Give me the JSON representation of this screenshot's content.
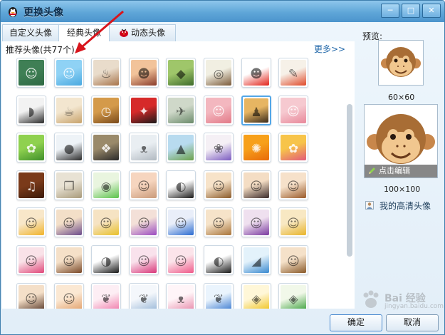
{
  "window": {
    "title": "更换头像",
    "accent_color": "#4b94cc",
    "controls": {
      "minimize_icon": "minimize-icon",
      "maximize_icon": "maximize-icon",
      "close_icon": "close-icon"
    }
  },
  "tabs": [
    {
      "label": "自定义头像",
      "active": false
    },
    {
      "label": "经典头像",
      "active": true
    },
    {
      "label": "动态头像",
      "active": false
    }
  ],
  "recommended": {
    "label": "推荐头像(共77个)",
    "more_link": "更多>>"
  },
  "avatars": [
    [
      "chalkboard-face",
      "sky-smile-face",
      "coffee-art",
      "opera-mask-lady",
      "penguin-photo",
      "latte-cup",
      "red-cartoon-face",
      "colored-pencils"
    ],
    [
      "computer-mouse",
      "tea-set",
      "clock-ornament",
      "opera-mask-red",
      "hummingbird",
      "pink-silhouette",
      "penguin-couple",
      "pink-silhouette-2"
    ],
    [
      "grass",
      "baby-penguin",
      "dog",
      "white-cat",
      "landscape-horse",
      "opera-costume",
      "orange-abstract",
      "pink-flower"
    ],
    [
      "violin",
      "book-glasses",
      "green-ring",
      "baby-face",
      "qq-penguin",
      "anime-boy-brown",
      "anime-boy-dark",
      "anime-girl-brown"
    ],
    [
      "anime-blonde",
      "anime-glasses",
      "anime-blonde-2",
      "anime-purple",
      "anime-blue",
      "anime-brown",
      "anime-purple-2",
      "anime-blonde-3"
    ],
    [
      "anime-pink",
      "anime-brown-2",
      "penguin-cool",
      "anime-pink-2",
      "anime-pink-3",
      "qq-penguin-bow",
      "dolphin",
      "anime-boy-smile"
    ],
    [
      "anime-boy-3",
      "cartoon-baby",
      "pink-bunny",
      "white-bunny",
      "white-cat-cartoon",
      "blue-bunny",
      "yellow-fish",
      "green-duck"
    ]
  ],
  "selected_avatar": "penguin-couple",
  "preview": {
    "label": "预览:",
    "size_small": "60×60",
    "size_large": "100×100",
    "edit_label": "点击编辑",
    "hd_link": "我的高清头像",
    "current_avatar": "monkey-face"
  },
  "buttons": {
    "ok": "确定",
    "cancel": "取消"
  },
  "watermark": {
    "brand": "Bai 经验",
    "url": "jingyan.baidu.com"
  }
}
